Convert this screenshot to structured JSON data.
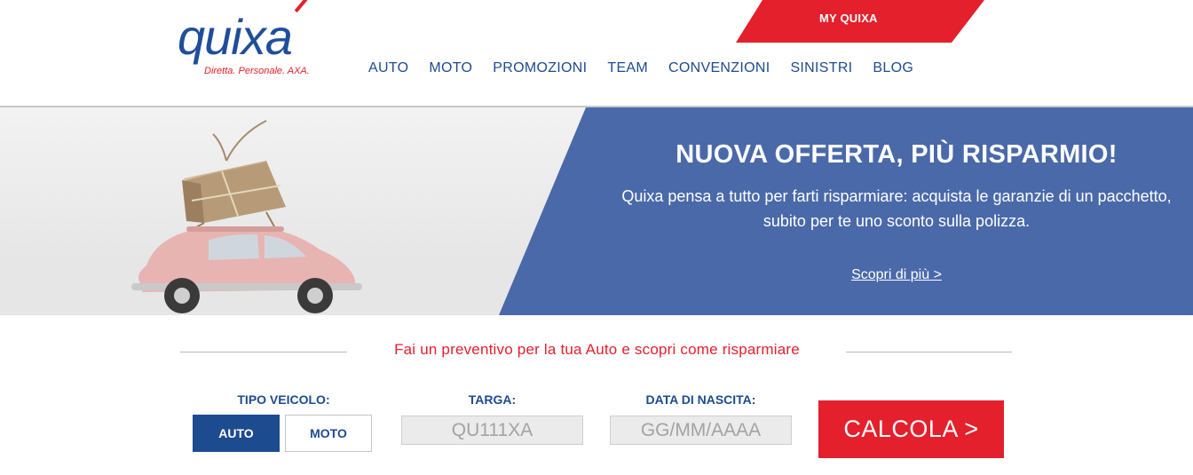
{
  "header": {
    "logo_text": "quixa",
    "logo_tagline": "Diretta. Personale. AXA.",
    "my_quixa_label": "MY QUIXA",
    "nav": [
      "AUTO",
      "MOTO",
      "PROMOZIONI",
      "TEAM",
      "CONVENZIONI",
      "SINISTRI",
      "BLOG"
    ]
  },
  "hero": {
    "title": "NUOVA OFFERTA, PIÙ RISPARMIO!",
    "text": "Quixa pensa a tutto per farti risparmiare: acquista le garanzie di un pacchetto, subito per te uno sconto sulla polizza.",
    "link": "Scopri di più >"
  },
  "quote": {
    "title": "Fai un preventivo per la tua Auto e scopri come risparmiare",
    "vehicle_label": "TIPO VEICOLO:",
    "vehicle_options": [
      "AUTO",
      "MOTO"
    ],
    "vehicle_selected": "AUTO",
    "plate_label": "TARGA:",
    "plate_placeholder": "QU111XA",
    "birth_label": "DATA DI NASCITA:",
    "birth_placeholder": "GG/MM/AAAA",
    "calc_button": "CALCOLA >"
  },
  "colors": {
    "brand_blue": "#1d4b8f",
    "brand_red": "#e4202c",
    "hero_panel": "#4a69a9"
  }
}
